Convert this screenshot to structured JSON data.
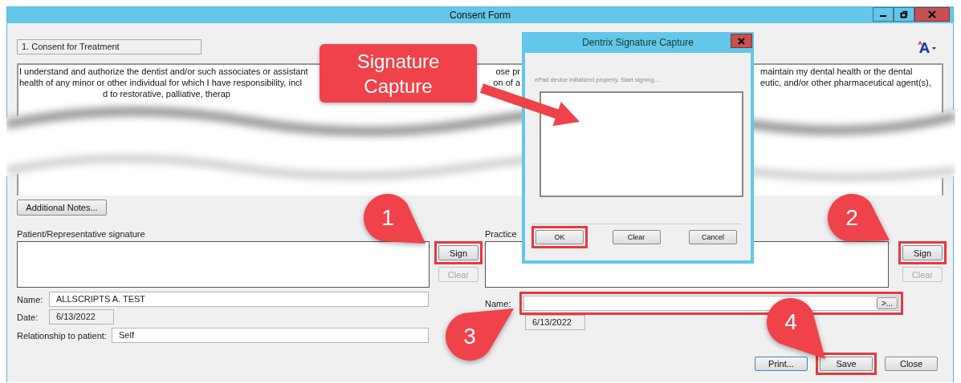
{
  "window": {
    "title": "Consent Form"
  },
  "section": "1. Consent for Treatment",
  "consent_text": [
    {
      "left": "I understand and authorize the dentist and/or such associates or assistant",
      "middle": "ose pr",
      "right": "maintain my dental health or the dental"
    },
    {
      "left": "health of any minor or other individual for which I have responsibility, incl",
      "middle": "on of a",
      "right": "eutic, and/or other pharmaceutical agent(s),"
    },
    {
      "left": "d to restorative, palliative, therap"
    }
  ],
  "additional_notes_button": "Additional Notes...",
  "patient": {
    "label": "Patient/Representative signature",
    "sign": {
      "label": "Sign",
      "highlighted": true
    },
    "clear": {
      "label": "Clear",
      "disabled": true
    },
    "name_label": "Name:",
    "name": "ALLSCRIPTS A. TEST",
    "date_label": "Date:",
    "date": "6/13/2022",
    "relationship_label": "Relationship to patient:",
    "relationship": "Self"
  },
  "practice": {
    "label": "Practice",
    "sign": {
      "label": "Sign",
      "highlighted": true
    },
    "clear": {
      "label": "Clear",
      "disabled": true
    },
    "name_label": "Name:",
    "name_field": {
      "highlighted": true
    },
    "lookup_button": ">...",
    "date": "6/13/2022"
  },
  "footer_buttons": [
    {
      "label": "Print...",
      "highlighted": false
    },
    {
      "label": "Save",
      "highlighted": true
    },
    {
      "label": "Close",
      "highlighted": false
    }
  ],
  "dialog": {
    "title": "Dentrix Signature Capture",
    "status": "ePad device initialized properly. Start signing....",
    "buttons": [
      {
        "label": "OK",
        "highlighted": true
      },
      {
        "label": "Clear",
        "highlighted": false
      },
      {
        "label": "Cancel",
        "highlighted": false
      }
    ]
  },
  "annotations": {
    "callout": "Signature Capture",
    "steps": [
      "1",
      "2",
      "3",
      "4"
    ]
  }
}
